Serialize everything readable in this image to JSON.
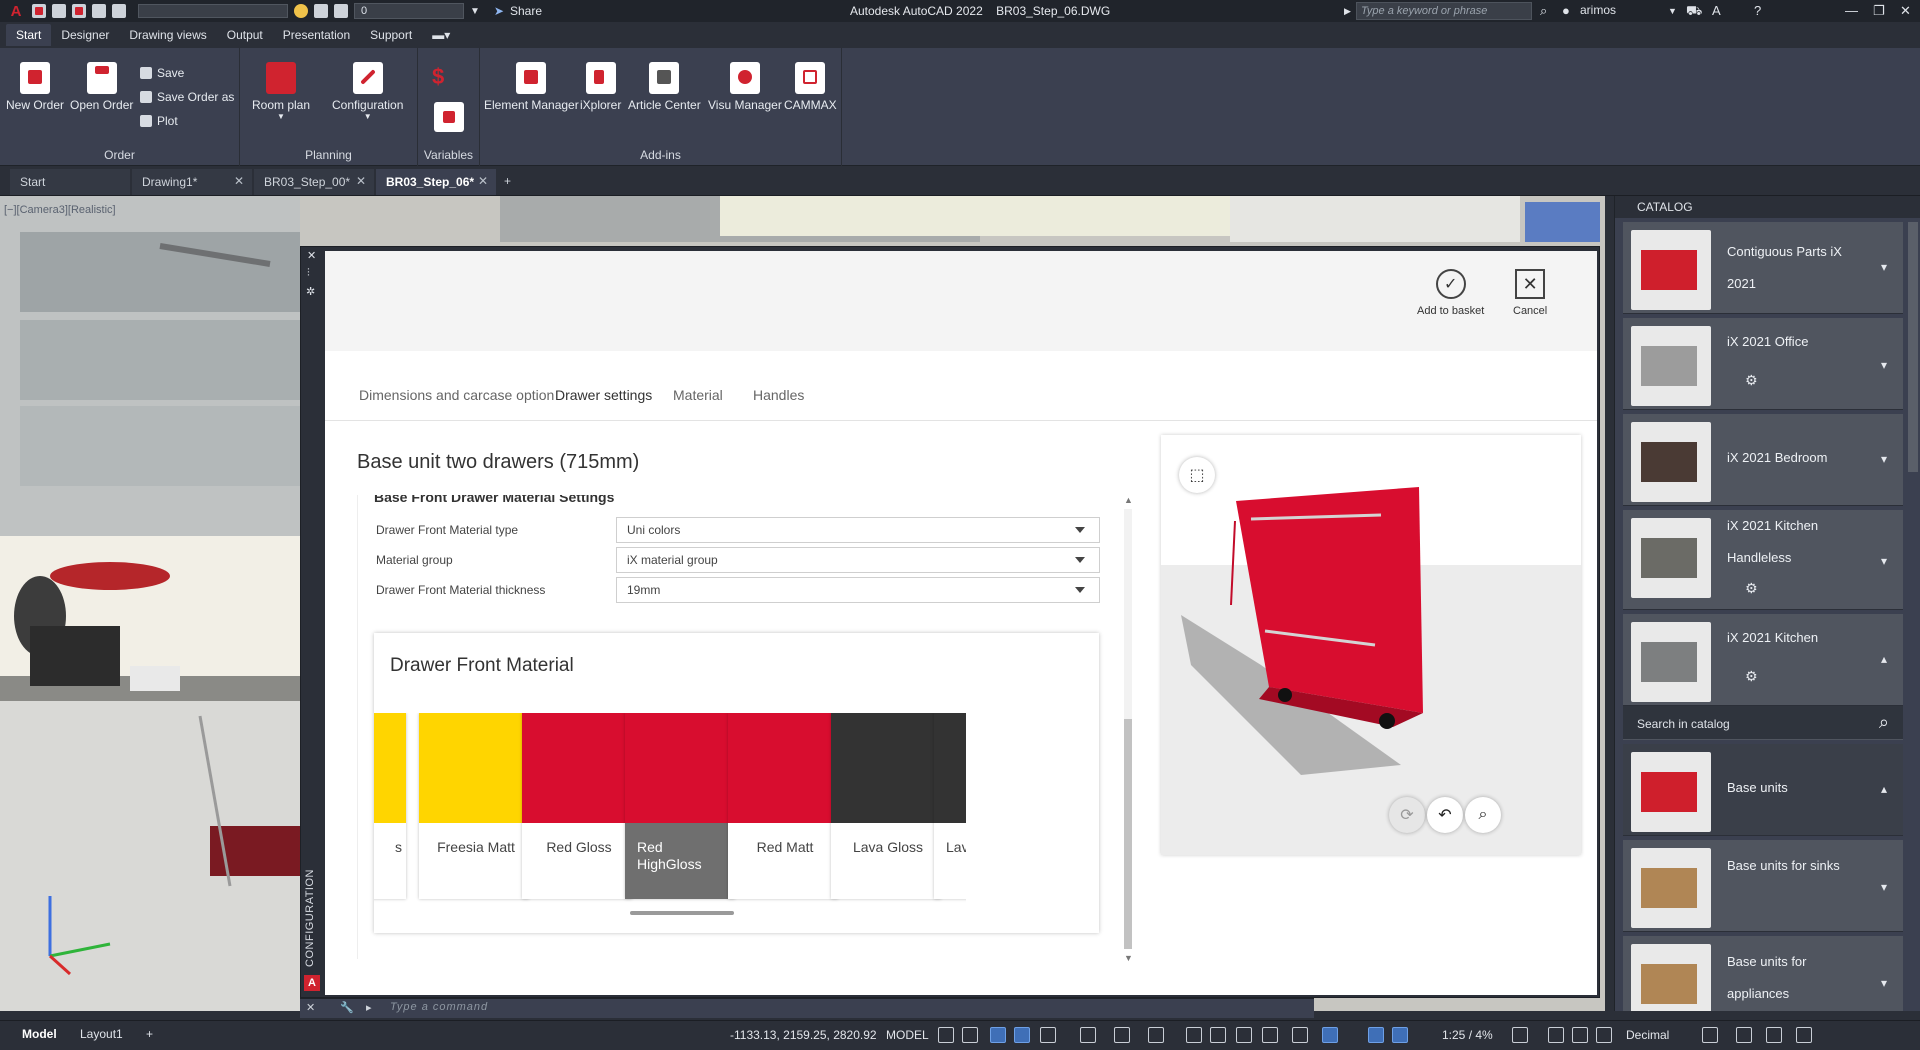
{
  "titlebar": {
    "app_title": "Autodesk AutoCAD 2022",
    "file_title": "BR03_Step_06.DWG",
    "layer_value": "0",
    "share_label": "Share",
    "search_placeholder": "Type a keyword or phrase",
    "user_name": "arimos"
  },
  "ribbon_tabs": [
    "Start",
    "Designer",
    "Drawing views",
    "Output",
    "Presentation",
    "Support"
  ],
  "ribbon": {
    "order": {
      "title": "Order",
      "new_order": "New Order",
      "open_order": "Open Order",
      "save": "Save",
      "save_order_as": "Save Order as",
      "plot": "Plot"
    },
    "planning": {
      "title": "Planning",
      "room_plan": "Room plan",
      "configuration": "Configuration"
    },
    "variables": {
      "title": "Variables"
    },
    "addins": {
      "title": "Add-ins",
      "element_manager": "Element Manager",
      "ixplorer": "iXplorer",
      "article_center": "Article Center",
      "visu_manager": "Visu Manager",
      "cammax": "CAMMAX"
    }
  },
  "doc_tabs": [
    "Start",
    "Drawing1*",
    "BR03_Step_00*",
    "BR03_Step_06*"
  ],
  "viewport": {
    "label": "[−][Camera3][Realistic]"
  },
  "config": {
    "side_label": "CONFIGURATION",
    "add_to_basket": "Add to basket",
    "cancel": "Cancel",
    "tabs": [
      "Dimensions and carcase option",
      "Drawer settings",
      "Material",
      "Handles"
    ],
    "unit_title": "Base unit two drawers (715mm)",
    "section_title": "Base Front Drawer Material Settings",
    "fields": [
      {
        "label": "Drawer Front Material type",
        "value": "Uni colors"
      },
      {
        "label": "Material group",
        "value": "iX material group"
      },
      {
        "label": "Drawer Front Material thickness",
        "value": "19mm"
      }
    ],
    "material_title": "Drawer Front Material",
    "swatches": [
      {
        "name": "s",
        "color": "#ffd500"
      },
      {
        "name": "Freesia Matt",
        "color": "#ffd500"
      },
      {
        "name": "Red Gloss",
        "color": "#d80d2f"
      },
      {
        "name": "Red HighGloss",
        "color": "#d80d2f"
      },
      {
        "name": "Red Matt",
        "color": "#d80d2f"
      },
      {
        "name": "Lava Gloss",
        "color": "#333333"
      },
      {
        "name": "Lava High",
        "color": "#333333"
      }
    ],
    "selected_swatch": "Red HighGloss"
  },
  "catalog": {
    "title": "CATALOG",
    "items": [
      {
        "name": "Contiguous Parts iX 2021"
      },
      {
        "name": "iX 2021 Office"
      },
      {
        "name": "iX 2021 Bedroom"
      },
      {
        "name": "iX 2021 Kitchen Handleless"
      },
      {
        "name": "iX 2021 Kitchen"
      }
    ],
    "search_label": "Search in catalog",
    "sub_items": [
      {
        "name": "Base units"
      },
      {
        "name": "Base units for sinks"
      },
      {
        "name": "Base units for appliances"
      }
    ]
  },
  "command": {
    "placeholder": "Type a command"
  },
  "status": {
    "model_tab": "Model",
    "layout_tab": "Layout1",
    "coords": "-1133.13, 2159.25, 2820.92",
    "model_label": "MODEL",
    "scale": "1:25 / 4%",
    "units": "Decimal"
  },
  "colors": {
    "accent_red": "#d0232f",
    "cabinet_red": "#d80d2f",
    "ribbon_bg": "#3b4050",
    "panel_bg": "#2b2f38"
  }
}
